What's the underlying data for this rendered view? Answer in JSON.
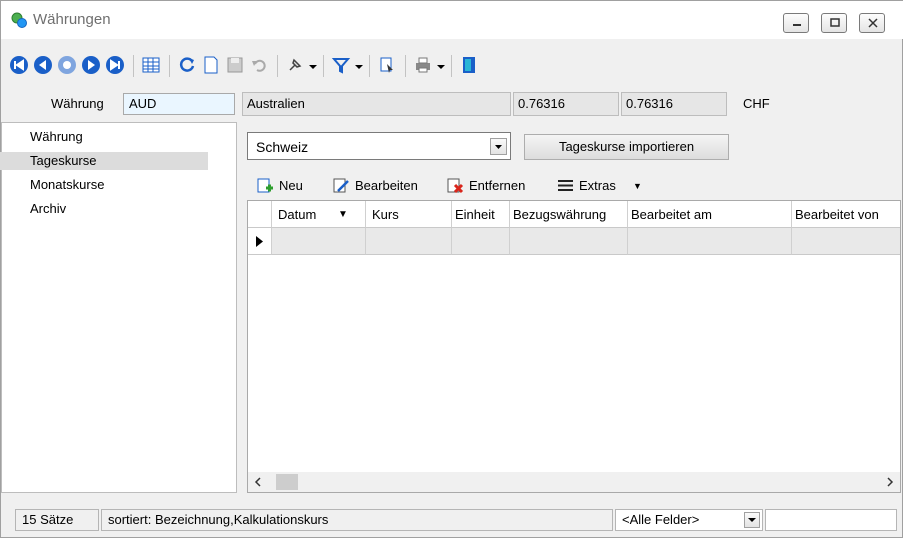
{
  "window": {
    "title": "Währungen"
  },
  "header": {
    "currency_label": "Währung",
    "currency_code": "AUD",
    "country": "Australien",
    "rate1": "0.76316",
    "rate2": "0.76316",
    "base_currency": "CHF"
  },
  "sidebar": {
    "items": [
      {
        "label": "Währung",
        "selected": false
      },
      {
        "label": "Tageskurse",
        "selected": true
      },
      {
        "label": "Monatskurse",
        "selected": false
      },
      {
        "label": "Archiv",
        "selected": false
      }
    ]
  },
  "content": {
    "country_select": "Schweiz",
    "import_button": "Tageskurse importieren",
    "subtoolbar": {
      "new": "Neu",
      "edit": "Bearbeiten",
      "remove": "Entfernen",
      "extras": "Extras"
    },
    "grid": {
      "columns": [
        "Datum",
        "Kurs",
        "Einheit",
        "Bezugswährung",
        "Bearbeitet am",
        "Bearbeitet von"
      ]
    }
  },
  "status": {
    "records": "15 Sätze",
    "sort": "sortiert: Bezeichnung,Kalkulationskurs",
    "field_filter": "<Alle Felder>",
    "search": ""
  },
  "colors": {
    "nav_blue": "#1a5fc8",
    "selection": "#dcdcdc",
    "delete_red": "#d9261c"
  }
}
